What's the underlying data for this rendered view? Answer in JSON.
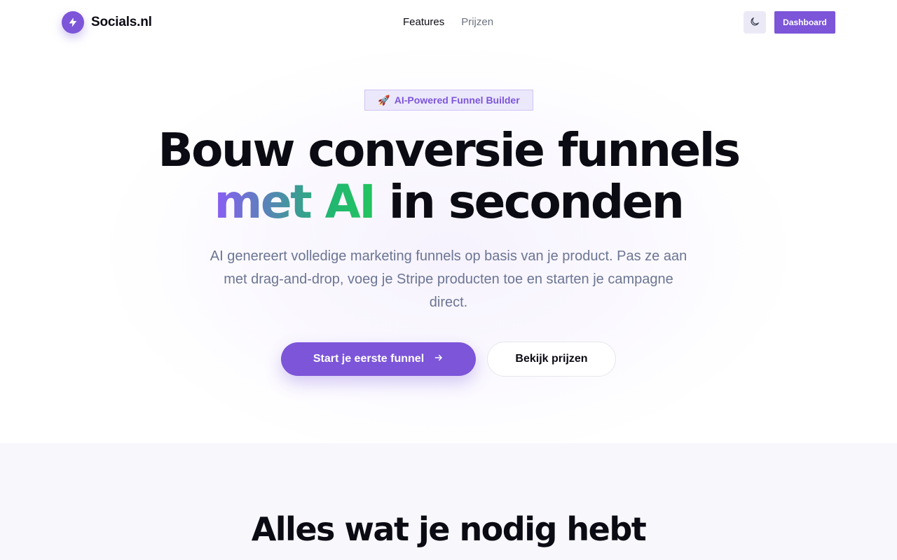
{
  "brand": {
    "name": "Socials.nl",
    "icon": "lightning-bolt-icon",
    "color": "#7c55d9"
  },
  "nav": {
    "items": [
      {
        "label": "Features",
        "active": true
      },
      {
        "label": "Prijzen",
        "active": false
      }
    ]
  },
  "header": {
    "theme_toggle_icon": "moon-icon",
    "dashboard_label": "Dashboard"
  },
  "hero": {
    "badge_emoji": "🚀",
    "badge_text": "AI-Powered Funnel Builder",
    "headline_line1": "Bouw conversie funnels",
    "headline_gradient": "met AI",
    "headline_rest": "in seconden",
    "subtitle": "AI genereert volledige marketing funnels op basis van je product. Pas ze aan met drag-and-drop, voeg je Stripe producten toe en starten je campagne direct.",
    "cta_primary": "Start je eerste funnel",
    "cta_primary_icon": "arrow-right-icon",
    "cta_secondary": "Bekijk prijzen"
  },
  "features": {
    "title": "Alles wat je nodig hebt"
  },
  "colors": {
    "accent": "#7c55d9",
    "gradient_start": "#8b5cf6",
    "gradient_end": "#22c55e",
    "text": "#0b0b14",
    "muted": "#6b7593"
  }
}
